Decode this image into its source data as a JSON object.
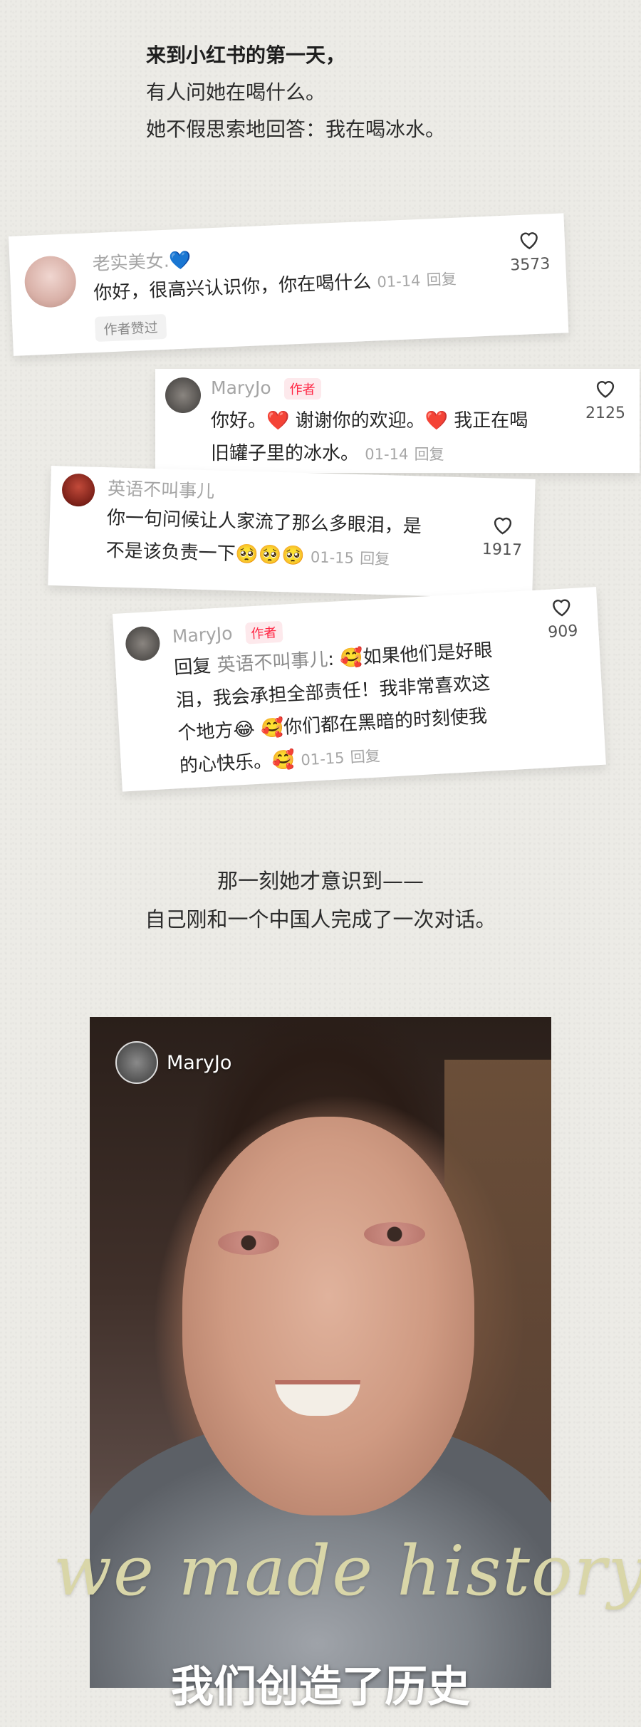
{
  "intro": {
    "line1": "来到小红书的第一天，",
    "line2": "有人问她在喝什么。",
    "line3": "她不假思索地回答：我在喝冰水。"
  },
  "comments": [
    {
      "username": "老实美女.",
      "badge_emoji": "💙",
      "text": "你好，很高兴认识你，你在喝什么",
      "date": "01-14",
      "reply_label": "回复",
      "likes": "3573",
      "liked_tag": "作者赞过"
    },
    {
      "username": "MaryJo",
      "author_tag": "作者",
      "text_line1": "你好。❤️ 谢谢你的欢迎。❤️ 我正在喝",
      "text_line2": "旧罐子里的冰水。",
      "date": "01-14",
      "reply_label": "回复",
      "likes": "2125"
    },
    {
      "username": "英语不叫事儿",
      "text_line1": "你一句问候让人家流了那么多眼泪，是",
      "text_line2": "不是该负责一下🥺🥺🥺",
      "date": "01-15",
      "reply_label": "回复",
      "likes": "1917"
    },
    {
      "username": "MaryJo",
      "author_tag": "作者",
      "reply_prefix": "回复",
      "mention": "英语不叫事儿",
      "text_line1": ": 🥰如果他们是好眼",
      "text_line2": "泪，我会承担全部责任！我非常喜欢这",
      "text_line3": "个地方😂 🥰你们都在黑暗的时刻使我",
      "text_line4": "的心快乐。🥰",
      "date": "01-15",
      "reply_label": "回复",
      "likes": "909"
    }
  ],
  "middle": {
    "line1": "那一刻她才意识到——",
    "line2": "自己刚和一个中国人完成了一次对话。"
  },
  "photo": {
    "username": "MaryJo",
    "script_text": "we made history",
    "subtitle": "我们创造了历史"
  },
  "icons": {
    "like": "heart-outline-icon"
  }
}
